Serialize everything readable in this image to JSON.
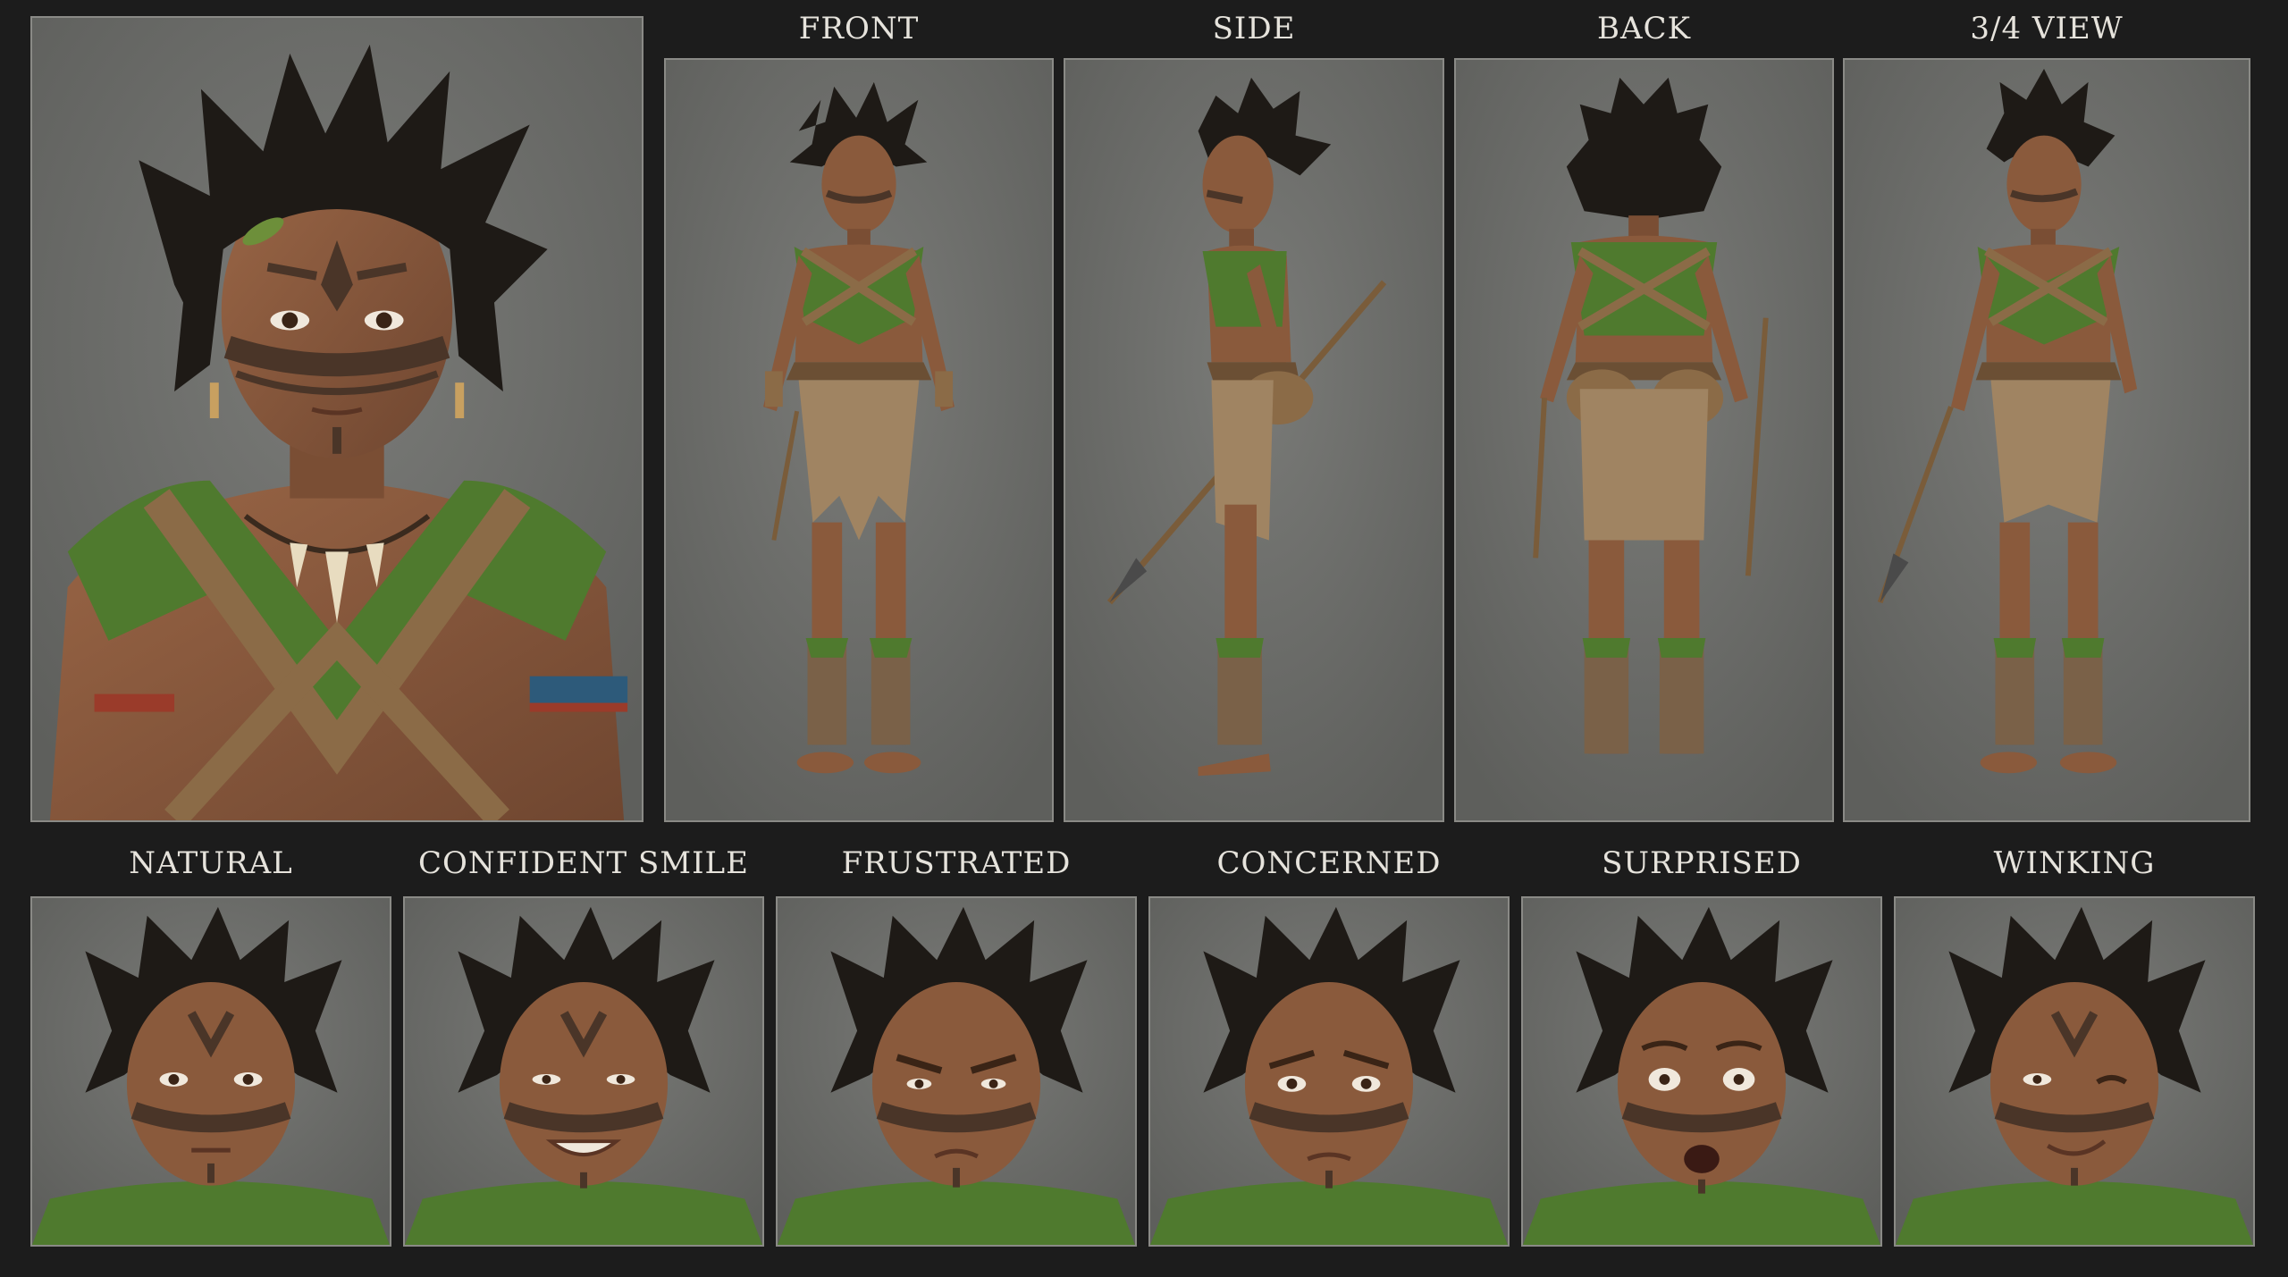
{
  "views": {
    "front": "FRONT",
    "side": "SIDE",
    "back": "BACK",
    "three_quarter": "3/4 VIEW"
  },
  "expressions": {
    "natural": "NATURAL",
    "confident_smile": "CONFIDENT SMILE",
    "frustrated": "FRUSTRATED",
    "concerned": "CONCERNED",
    "surprised": "SURPRISED",
    "winking": "WINKING"
  },
  "colors": {
    "background": "#1c1c1c",
    "panel": "#6e6f6c",
    "skin": "#8a5a3c",
    "hair": "#1e1a16",
    "leaf": "#4f7a2e",
    "leather": "#8b6b47",
    "paint": "#4a3528"
  }
}
